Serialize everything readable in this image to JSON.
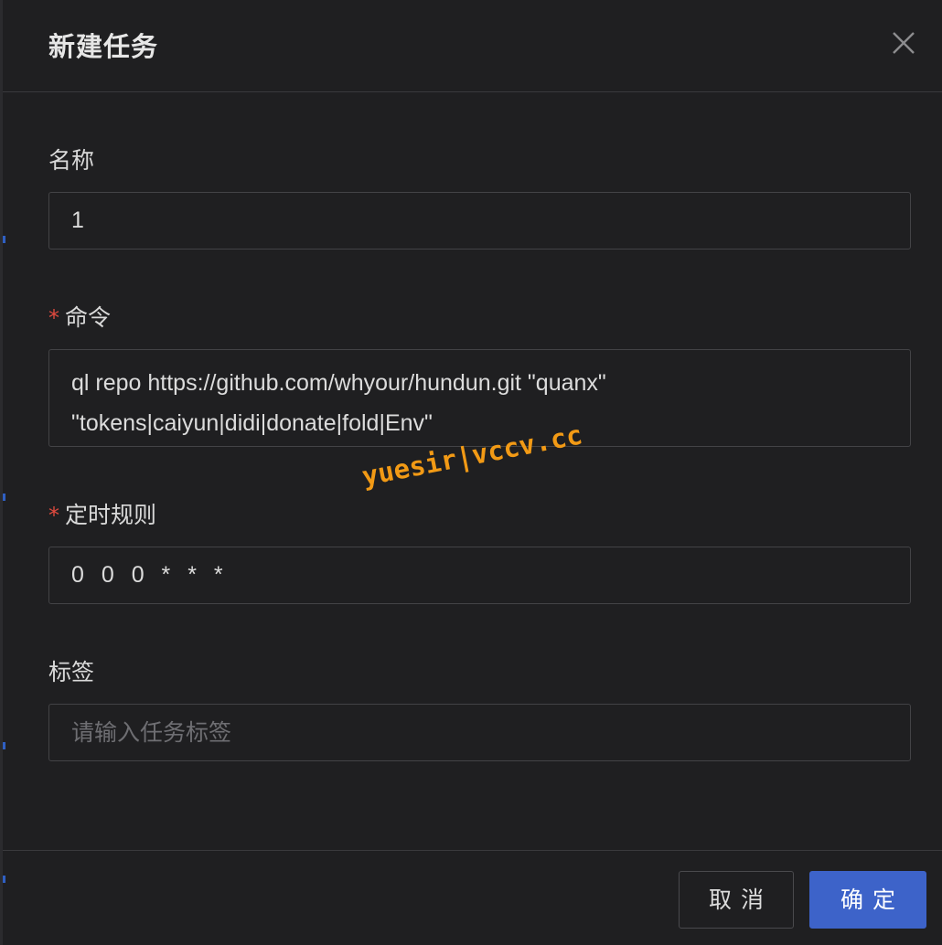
{
  "modal": {
    "title": "新建任务"
  },
  "form": {
    "name": {
      "label": "名称",
      "value": "1"
    },
    "command": {
      "required_mark": "*",
      "label": "命令",
      "value": "ql repo https://github.com/whyour/hundun.git \"quanx\"\n\"tokens|caiyun|didi|donate|fold|Env\""
    },
    "schedule": {
      "required_mark": "*",
      "label": "定时规则",
      "value": "0 0 0 * * *"
    },
    "tags": {
      "label": "标签",
      "placeholder": "请输入任务标签"
    }
  },
  "watermark": "yuesir|vccv.cc",
  "footer": {
    "cancel_label": "取消",
    "ok_label": "确定"
  },
  "colors": {
    "background": "#1f1f21",
    "primary": "#3d63c9",
    "required": "#e04a3f",
    "watermark": "#f29a15"
  },
  "icons": {
    "close": "close-icon"
  }
}
